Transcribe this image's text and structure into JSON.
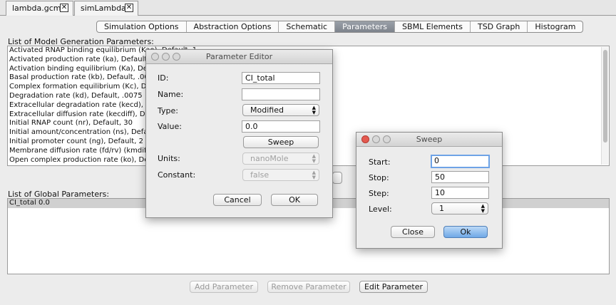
{
  "doc_tabs": [
    {
      "label": "lambda.gcm",
      "close": "✕"
    },
    {
      "label": "simLambda",
      "close": "✕"
    }
  ],
  "tabs": [
    {
      "label": "Simulation Options"
    },
    {
      "label": "Abstraction Options"
    },
    {
      "label": "Schematic"
    },
    {
      "label": "Parameters"
    },
    {
      "label": "SBML Elements"
    },
    {
      "label": "TSD Graph"
    },
    {
      "label": "Histogram"
    }
  ],
  "active_tab": "Parameters",
  "model_params": {
    "label": "List of Model Generation Parameters:",
    "items": [
      "Activated RNAP binding equilibrium (Kao), Default, 1",
      "Activated production rate (ka), Default, .25",
      "Activation binding equilibrium (Ka), Default, .0033",
      "Basal production rate (kb), Default, .0001",
      "Complex formation equilibrium (Kc), Default, .05",
      "Degradation rate (kd), Default, .0075",
      "Extracellular degradation rate (kecd), Default, .005",
      "Extracellular diffusion rate (kecdiff), Default, 1",
      "Initial RNAP count (nr), Default, 30",
      "Initial amount/concentration (ns), Default, 0",
      "Initial promoter count (ng), Default, 2",
      "Membrane diffusion rate (fd/rv) (kmdiff), Default, 1/0.01",
      "Open complex production rate (ko), Default, .05"
    ]
  },
  "global_params": {
    "label": "List of Global Parameters:",
    "items": [
      "CI_total 0.0"
    ]
  },
  "buttons": {
    "add": "Add Parameter",
    "remove": "Remove Parameter",
    "edit": "Edit Parameter"
  },
  "param_editor": {
    "title": "Parameter Editor",
    "id_label": "ID:",
    "id_value": "CI_total",
    "name_label": "Name:",
    "name_value": "",
    "type_label": "Type:",
    "type_value": "Modified",
    "value_label": "Value:",
    "value_value": "0.0",
    "sweep_button": "Sweep",
    "units_label": "Units:",
    "units_value": "nanoMole",
    "constant_label": "Constant:",
    "constant_value": "false",
    "cancel": "Cancel",
    "ok": "OK"
  },
  "sweep": {
    "title": "Sweep",
    "start_label": "Start:",
    "start_value": "0",
    "stop_label": "Stop:",
    "stop_value": "50",
    "step_label": "Step:",
    "step_value": "10",
    "level_label": "Level:",
    "level_value": "1",
    "close": "Close",
    "ok": "Ok"
  },
  "colors": {
    "active_tab_bg": "#8a9099",
    "focus_ring": "#6ea3e6",
    "default_button": "#6fa8e6",
    "close_light": "#e45a50"
  }
}
